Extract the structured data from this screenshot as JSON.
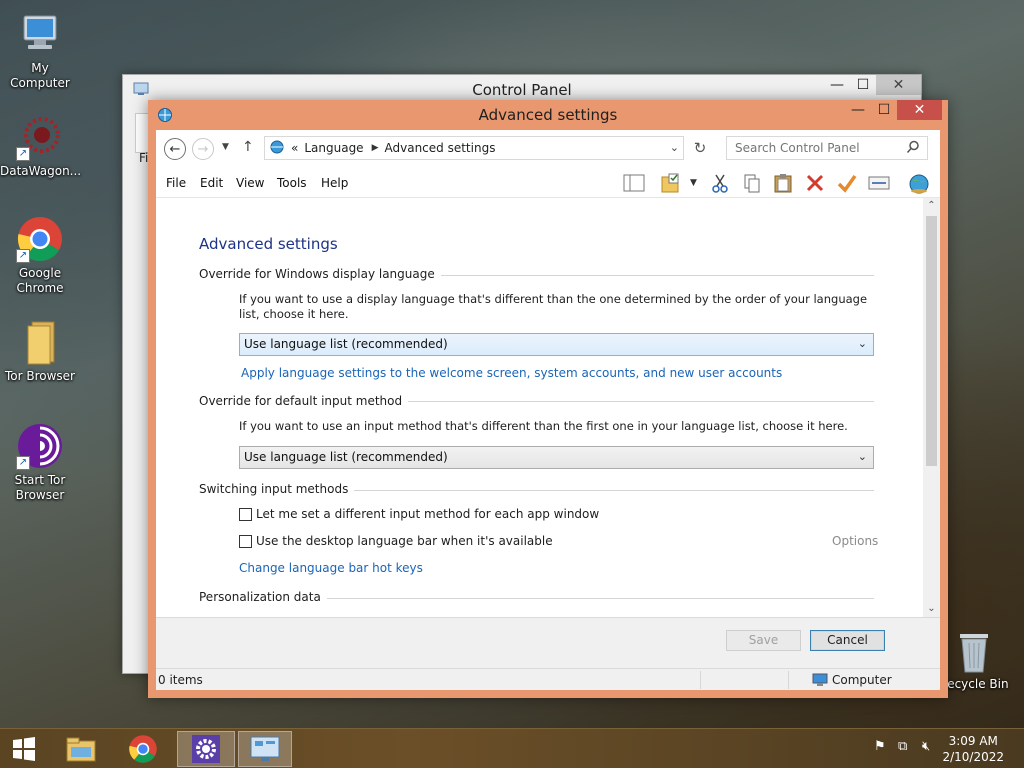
{
  "desktop": {
    "icons": [
      {
        "label": "My Computer"
      },
      {
        "label": "DataWagon..."
      },
      {
        "label": "Google Chrome"
      },
      {
        "label": "Tor Browser"
      },
      {
        "label": "Start Tor Browser"
      },
      {
        "label": "Recycle Bin"
      }
    ]
  },
  "bg_window": {
    "title": "Control Panel",
    "fragment": "Fi"
  },
  "window": {
    "title": "Advanced settings",
    "address": {
      "crumbs": [
        "Language",
        "Advanced settings"
      ],
      "prefix": "«"
    },
    "search_placeholder": "Search Control Panel",
    "menu": [
      "File",
      "Edit",
      "View",
      "Tools",
      "Help"
    ]
  },
  "content": {
    "heading": "Advanced settings",
    "display_language": {
      "section": "Override for Windows display language",
      "description": "If you want to use a display language that's different than the one determined by the order of your language list, choose it here.",
      "selected": "Use language list (recommended)",
      "link": "Apply language settings to the welcome screen, system accounts, and new user accounts"
    },
    "input_method": {
      "section": "Override for default input method",
      "description": "If you want to use an input method that's different than the first one in your language list, choose it here.",
      "selected": "Use language list (recommended)"
    },
    "switching": {
      "section": "Switching input methods",
      "checkbox1": "Let me set a different input method for each app window",
      "checkbox2": "Use the desktop language bar when it's available",
      "options": "Options",
      "link": "Change language bar hot keys"
    },
    "personalization": {
      "section": "Personalization data"
    }
  },
  "buttons": {
    "save": "Save",
    "cancel": "Cancel"
  },
  "status": {
    "items": "0 items",
    "location": "Computer"
  },
  "taskbar": {
    "time": "3:09 AM",
    "date": "2/10/2022"
  },
  "colors": {
    "window_frame": "#e8976e",
    "close_button": "#c7504a",
    "link": "#1a65b7",
    "heading": "#1e3287"
  }
}
